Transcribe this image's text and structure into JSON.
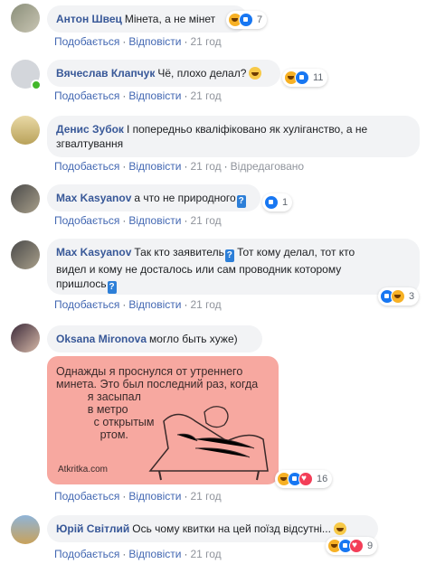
{
  "comments": [
    {
      "author": "Антон Швец",
      "text": "Мінета, а не мінет",
      "actions": {
        "like": "Подобається",
        "reply": "Відповісти",
        "time": "21 год"
      },
      "reactions_count": "7"
    },
    {
      "author": "Вячеслав Клапчук",
      "text": "Чё, плохо делал?",
      "actions": {
        "like": "Подобається",
        "reply": "Відповісти",
        "time": "21 год"
      },
      "reactions_count": "11"
    },
    {
      "author": "Денис Зубок",
      "text": "І попередньо кваліфіковано як хуліганство, а не",
      "text2": "згвалтування",
      "actions": {
        "like": "Подобається",
        "reply": "Відповісти",
        "time": "21 год",
        "edited": "Відредаговано"
      }
    },
    {
      "author": "Max Kasyanov",
      "text": "а что не природного",
      "actions": {
        "like": "Подобається",
        "reply": "Відповісти",
        "time": "21 год"
      },
      "reactions_count": "1"
    },
    {
      "author": "Max Kasyanov",
      "text": "Так кто заявитель",
      "text_b": "  Тот кому делал, тот кто",
      "text2": "видел и кому не досталось или сам проводник которому",
      "text3": "пришлось",
      "actions": {
        "like": "Подобається",
        "reply": "Відповісти",
        "time": "21 год"
      },
      "reactions_count": "3"
    },
    {
      "author": "Oksana Mironova",
      "text": "могло быть хуже)",
      "meme_text": "Однажды я проснулся от утреннего\nминета. Это был последний раз, когда\n          я засыпал\n          в метро\n            с открытым\n              ртом.",
      "meme_brand": "Atkritka.com",
      "actions": {
        "like": "Подобається",
        "reply": "Відповісти",
        "time": "21 год"
      },
      "reactions_count": "16"
    },
    {
      "author": "Юрій Світлий",
      "text": "Ось чому квитки на цей поїзд відсутні...",
      "actions": {
        "like": "Подобається",
        "reply": "Відповісти",
        "time": "21 год"
      },
      "reactions_count": "9"
    }
  ],
  "colors": {
    "author": "#385898",
    "link": "#4267b2",
    "bubble": "#f2f3f5"
  }
}
